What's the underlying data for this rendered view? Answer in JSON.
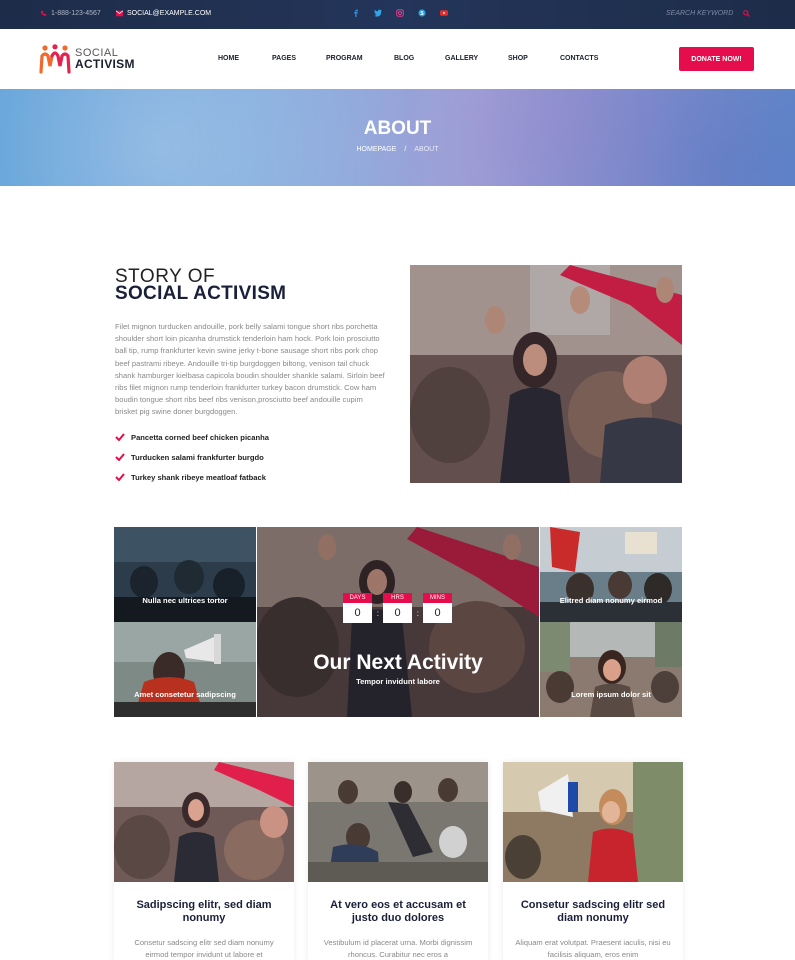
{
  "topbar": {
    "phone": "1-888-123-4567",
    "email": "SOCIAL@EXAMPLE.COM",
    "socials": [
      "facebook-icon",
      "twitter-icon",
      "instagram-icon",
      "skype-icon",
      "youtube-icon"
    ],
    "search_placeholder": "SEARCH KEYWORD"
  },
  "header": {
    "logo_line1": "SOCIAL",
    "logo_line2": "ACTIVISM",
    "nav": [
      "HOME",
      "PAGES",
      "PROGRAM",
      "BLOG",
      "GALLERY",
      "SHOP",
      "CONTACTS"
    ],
    "donate": "DONATE NOW!"
  },
  "hero": {
    "title": "ABOUT",
    "crumb_home": "HOMEPAGE",
    "crumb_sep": "/",
    "crumb_current": "ABOUT"
  },
  "story": {
    "title_small": "STORY OF",
    "title_big": "SOCIAL ACTIVISM",
    "paragraph": "Filet mignon turducken andouille, pork belly salami tongue short ribs porchetta shoulder short loin picanha drumstick tenderloin ham hock. Pork loin prosciutto ball tip, rump frankfurter kevin swine jerky t-bone sausage short ribs pork chop beef pastrami ribeye. Andouille tri-tip burgdoggen biltong, venison tail chuck shank hamburger kielbasa capicola boudin shoulder shankle salami. Sirloin beef ribs filet mignon rump tenderloin frankfurter turkey bacon drumstick. Cow ham boudin tongue short ribs beef ribs venison,prosciutto beef andouille cupim brisket pig swine doner burgdoggen.",
    "checks": [
      "Pancetta corned beef chicken picanha",
      "Turducken salami frankfurter burgdo",
      "Turkey shank ribeye meatloaf fatback"
    ]
  },
  "gallery": {
    "tile1": "Nulla nec ultrices tortor",
    "tile2": "Amet consetetur sadipscing",
    "tile3": "Elitred diam nonumy eirmod",
    "tile4": "Lorem ipsum dolor sit",
    "center_title": "Our Next Activity",
    "center_sub": "Tempor invidunt labore",
    "countdown": [
      {
        "label": "DAYS",
        "value": "0"
      },
      {
        "label": "HRS",
        "value": "0"
      },
      {
        "label": "MINS",
        "value": "0"
      }
    ]
  },
  "cards": [
    {
      "title": "Sadipscing elitr, sed diam nonumy",
      "text": "Consetur sadscing elitr sed diam nonumy eirmod tempor invidunt ut labore et"
    },
    {
      "title": "At vero eos et accusam et justo duo dolores",
      "text": "Vestibulum id placerat urna. Morbi dignissim rhoncus. Curabitur nec eros a"
    },
    {
      "title": "Consetur sadscing elitr sed diam nonumy",
      "text": "Aliquam erat volutpat. Praesent iaculis, nisi eu facilisis aliquam, eros enim"
    }
  ],
  "colors": {
    "accent": "#e60d4c",
    "topbar": "#1d2c48",
    "heading": "#1a1f3a"
  }
}
